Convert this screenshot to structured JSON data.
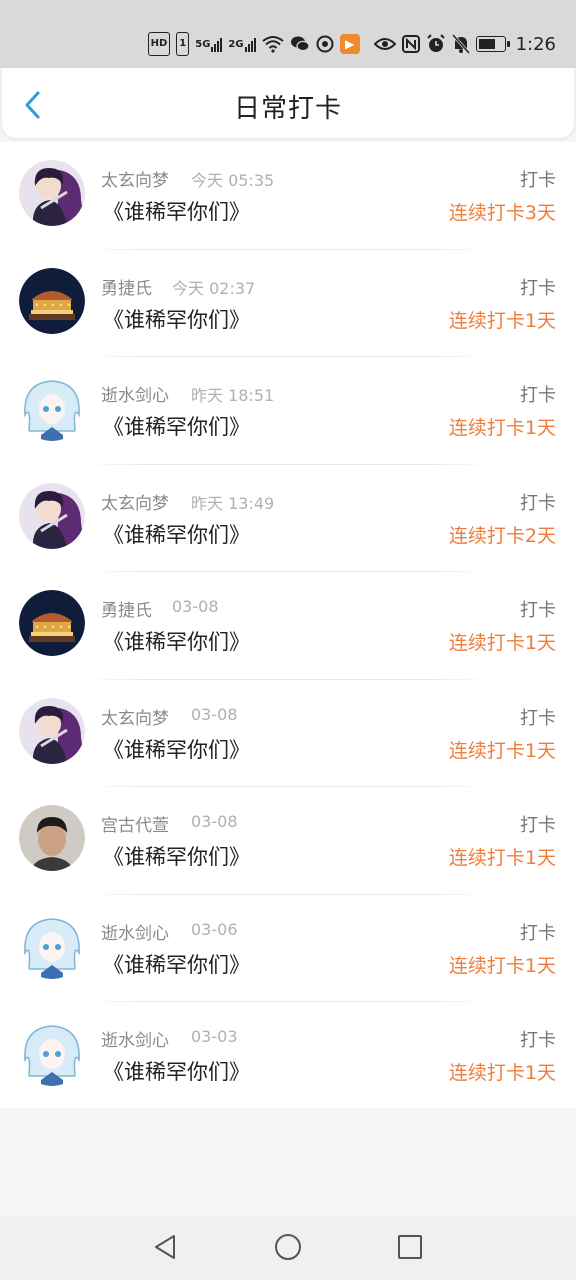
{
  "status_bar": {
    "hd": "HD",
    "sim": "1",
    "net1": "5G",
    "net2": "2G",
    "time": "1:26"
  },
  "header": {
    "title": "日常打卡"
  },
  "checkins": [
    {
      "name": "太玄向梦",
      "time": "今天 05:35",
      "book": "《谁稀罕你们》",
      "action": "打卡",
      "streak": "连续打卡3天",
      "avatar": "avatar-anime-purple"
    },
    {
      "name": "勇捷氏",
      "time": "今天 02:37",
      "book": "《谁稀罕你们》",
      "action": "打卡",
      "streak": "连续打卡1天",
      "avatar": "avatar-carousel"
    },
    {
      "name": "逝水剑心",
      "time": "昨天 18:51",
      "book": "《谁稀罕你们》",
      "action": "打卡",
      "streak": "连续打卡1天",
      "avatar": "avatar-anime-white"
    },
    {
      "name": "太玄向梦",
      "time": "昨天 13:49",
      "book": "《谁稀罕你们》",
      "action": "打卡",
      "streak": "连续打卡2天",
      "avatar": "avatar-anime-purple"
    },
    {
      "name": "勇捷氏",
      "time": "03-08",
      "book": "《谁稀罕你们》",
      "action": "打卡",
      "streak": "连续打卡1天",
      "avatar": "avatar-carousel"
    },
    {
      "name": "太玄向梦",
      "time": "03-08",
      "book": "《谁稀罕你们》",
      "action": "打卡",
      "streak": "连续打卡1天",
      "avatar": "avatar-anime-purple"
    },
    {
      "name": "宫古代萱",
      "time": "03-08",
      "book": "《谁稀罕你们》",
      "action": "打卡",
      "streak": "连续打卡1天",
      "avatar": "avatar-photo"
    },
    {
      "name": "逝水剑心",
      "time": "03-06",
      "book": "《谁稀罕你们》",
      "action": "打卡",
      "streak": "连续打卡1天",
      "avatar": "avatar-anime-white"
    },
    {
      "name": "逝水剑心",
      "time": "03-03",
      "book": "《谁稀罕你们》",
      "action": "打卡",
      "streak": "连续打卡1天",
      "avatar": "avatar-anime-white"
    }
  ],
  "colors": {
    "accent": "#f07d3a",
    "back_icon": "#2e9bdc"
  }
}
